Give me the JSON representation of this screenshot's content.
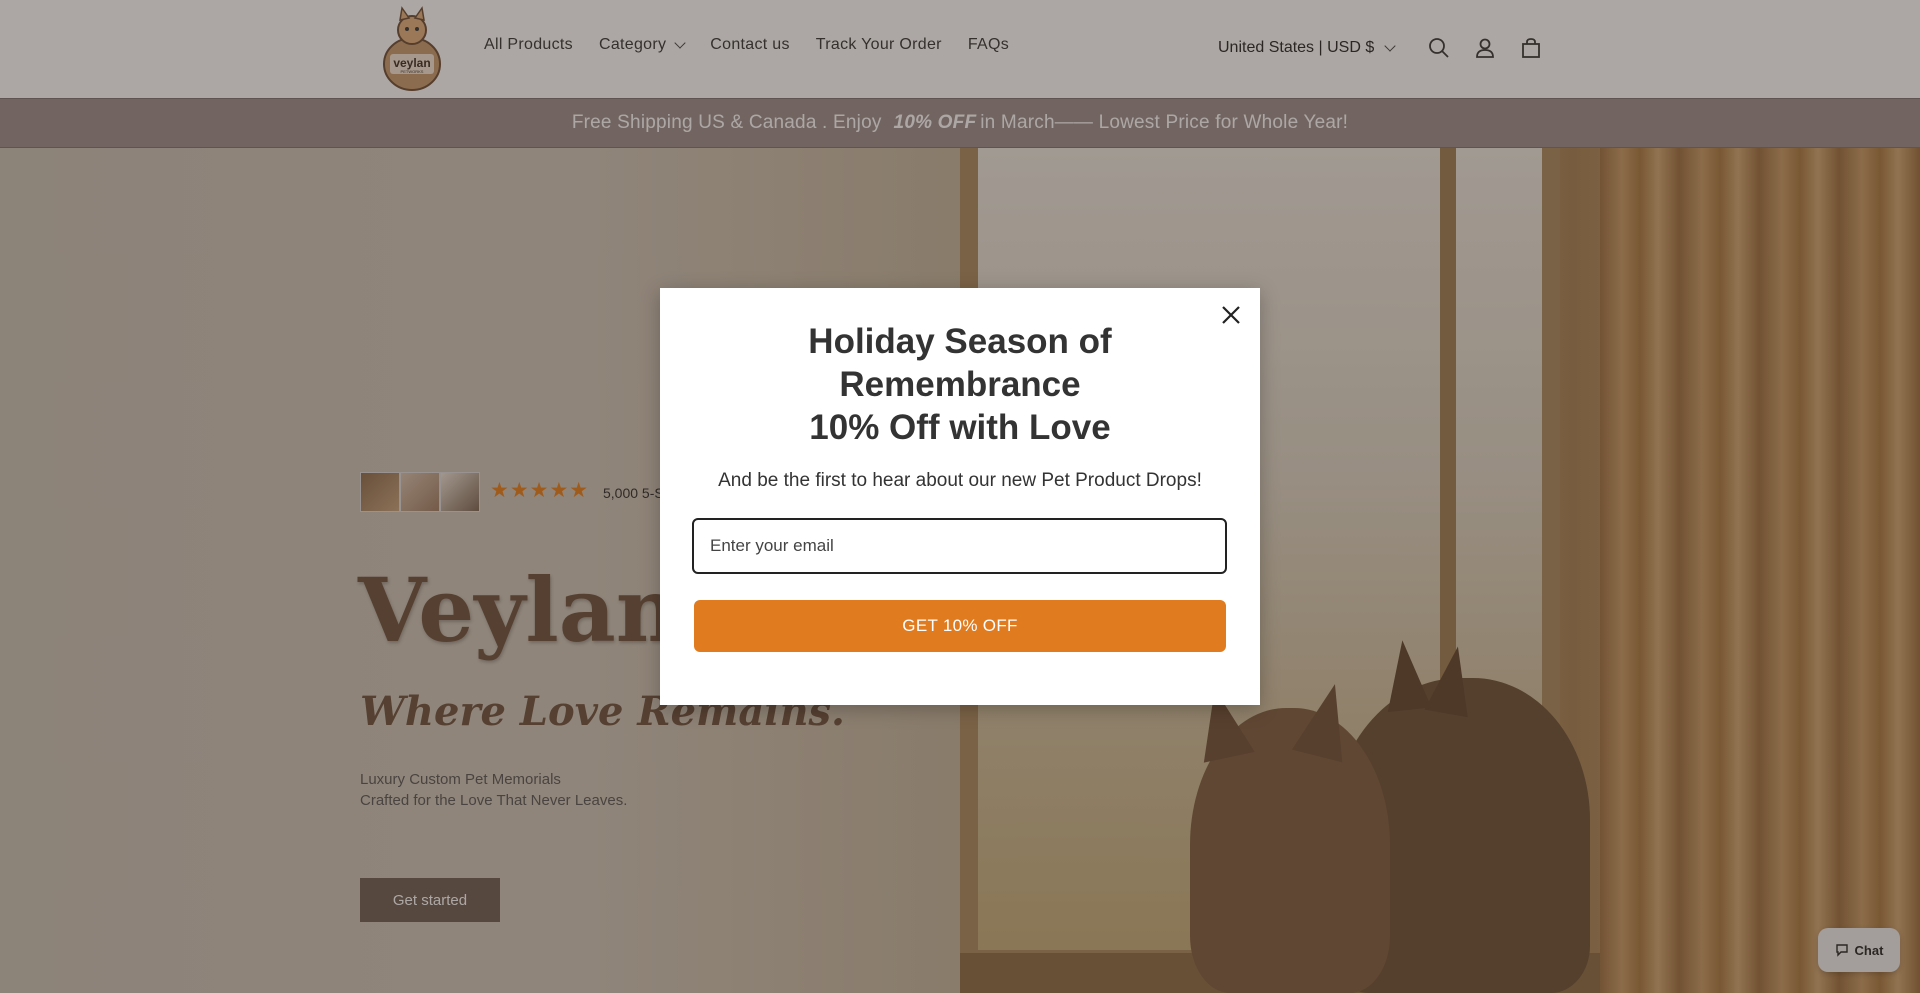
{
  "header": {
    "logo_text": "veylan",
    "logo_sub": "PETWORKS",
    "nav": [
      {
        "label": "All Products"
      },
      {
        "label": "Category"
      },
      {
        "label": "Contact us"
      },
      {
        "label": "Track Your Order"
      },
      {
        "label": "FAQs"
      }
    ],
    "currency": "United States | USD $",
    "icons": [
      "search-icon",
      "account-icon",
      "cart-icon"
    ]
  },
  "announcement": {
    "before": "Free Shipping US & Canada . Enjoy",
    "highlight": "10% OFF",
    "after": "in March—— Lowest Price for Whole Year!"
  },
  "hero": {
    "stars": "★★★★★",
    "rating_text": "5,000  5-S",
    "title": "Veylan P",
    "tagline": "Where Love Remains.",
    "desc_line1": "Luxury Custom Pet Memorials",
    "desc_line2": "Crafted for the Love That Never Leaves.",
    "cta": "Get started"
  },
  "modal": {
    "title_line1": "Holiday Season of",
    "title_line2": "Remembrance",
    "title_line3": "10% Off with Love",
    "subtitle": "And be the first to hear about our new Pet Product Drops!",
    "email_placeholder": "Enter your email",
    "button": "GET 10% OFF"
  },
  "chat": {
    "label": "Chat"
  },
  "colors": {
    "accent": "#e07b1f",
    "announcement_bg": "#9b8e8c",
    "star": "#e87c16",
    "cta_bg": "#6b5a52"
  }
}
